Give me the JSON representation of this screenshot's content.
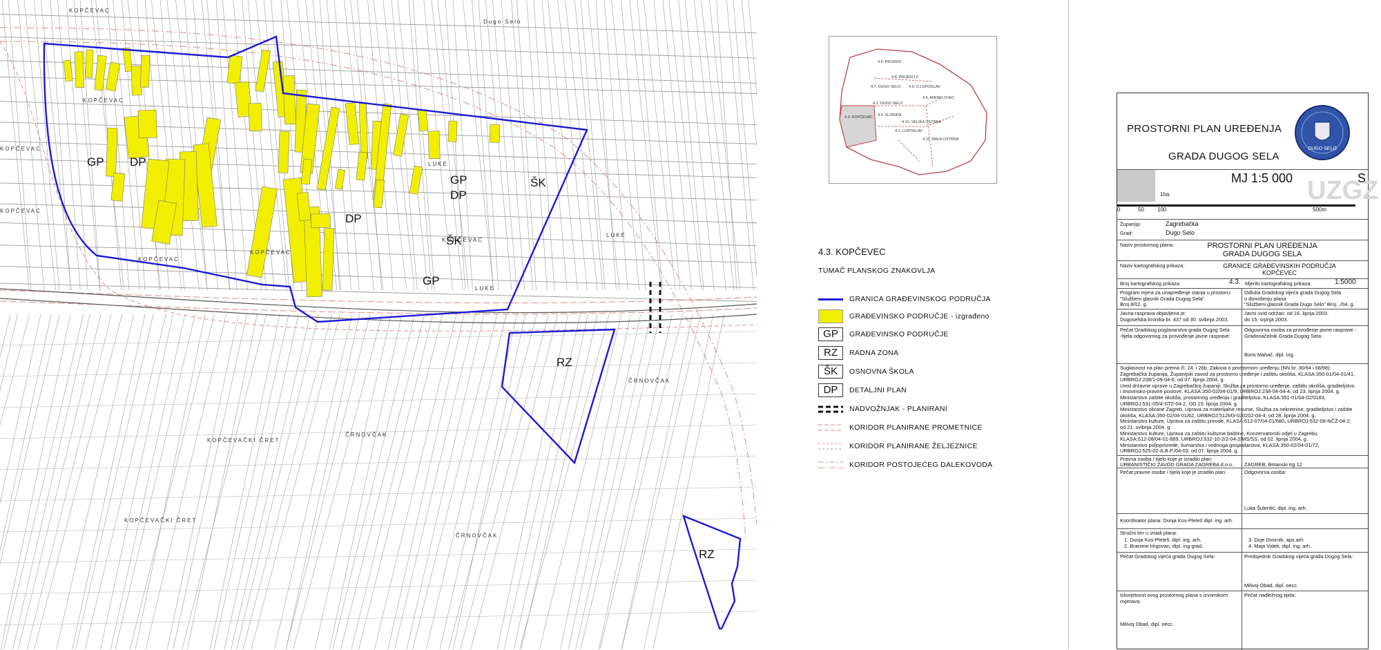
{
  "map": {
    "zone_labels": [
      {
        "text": "GP",
        "kind": "gp"
      },
      {
        "text": "DP",
        "kind": "dp"
      },
      {
        "text": "GP",
        "kind": "gp"
      },
      {
        "text": "DP",
        "kind": "dp"
      },
      {
        "text": "ŠK",
        "kind": "sk"
      },
      {
        "text": "DP",
        "kind": "dp"
      },
      {
        "text": "ŠK",
        "kind": "sk"
      },
      {
        "text": "GP",
        "kind": "gp"
      },
      {
        "text": "RZ",
        "kind": "rz"
      },
      {
        "text": "RZ",
        "kind": "rz"
      }
    ],
    "place_names": [
      "KOPČEVAC",
      "KOPČEVAC",
      "KOPČEVAC",
      "KOPČEVAC",
      "KOPČEVAC",
      "KOPČEVAC",
      "KOPČEVAC",
      "LUKE",
      "LUKE",
      "LUKE",
      "ČRNOVČAK",
      "ČRNOVČAK",
      "ČRNOVČAK",
      "KOPČEVAČKI ČRET",
      "KOPČEVAČKI ČRET",
      "Dugo Selo"
    ],
    "colors": {
      "boundary": "#1a1ad6",
      "built": "#f2ee00",
      "corridor": "#e08a8a"
    }
  },
  "index_map": {
    "areas": [
      "4.6. PRIJEKO",
      "4.8. PRIJEKO II",
      "4.7. DUGO SELO",
      "4.9. O.LUPOGLAV",
      "4.1. DUGO SELO",
      "4.5. ANDRILOVEC",
      "4.3. KOPČEVAC",
      "4.4. FLORIDA",
      "4.10. VELIKA OSTRNA",
      "4.2. LUPOGLAV",
      "4.11. MALA OSTRNA"
    ],
    "highlighted": "4.3. KOPČEVAC"
  },
  "legend": {
    "title": "4.3. KOPČEVEC",
    "subtitle": "TUMAČ PLANSKOG ZNAKOVLJA",
    "items": [
      {
        "symbol": "line-blue",
        "label": "GRANICA GRAĐEVINSKOG PODRUČJA"
      },
      {
        "symbol": "fill-yellow",
        "label": "GRAĐEVINSKO PODRUČJE - izgrađeno"
      },
      {
        "symbol": "GP",
        "label": "GRAĐEVINSKO PODRUČJE"
      },
      {
        "symbol": "RZ",
        "label": "RADNA ZONA"
      },
      {
        "symbol": "ŠK",
        "label": "OSNOVNA ŠKOLA"
      },
      {
        "symbol": "DP",
        "label": "DETALJNI PLAN"
      },
      {
        "symbol": "dashes",
        "label": "NADVOŽNJAK - PLANIRANI"
      },
      {
        "symbol": "corridor-road",
        "label": "KORIDOR PLANIRANE PROMETNICE"
      },
      {
        "symbol": "corridor-rail",
        "label": "KORIDOR PLANIRANE ŽELJEZNICE"
      },
      {
        "symbol": "corridor-power",
        "label": "KORIDOR POSTOJEĆEG DALEKOVODA"
      }
    ]
  },
  "title_block": {
    "title_line1": "PROSTORNI PLAN UREĐENJA",
    "title_line2": "GRADA DUGOG SELA",
    "seal_text": "DUGO SELO",
    "scale_label": "MJ 1:5 000",
    "north": "S",
    "watermark": "UZGZ",
    "scale_area": "1ha",
    "scale_ticks": [
      "0",
      "50",
      "100",
      "500m"
    ],
    "zupanija_label": "Županija:",
    "zupanija": "Zagrebačka",
    "grad_label": "Grad:",
    "grad": "Dugo Selo",
    "plan_name_label": "Naziv prostornog plana:",
    "plan_name": "PROSTORNI PLAN UREĐENJA\nGRADA DUGOG SELA",
    "map_name_label": "Naziv kartografskog prikaza:",
    "map_name": "GRANICE GRAĐEVINSKIH PODRUČJA\nKOPČEVEC",
    "map_no_label": "Broj kartografskog prikaza:",
    "map_no": "4.3.",
    "map_scale_label": "Mjerilo kartografskog prikaza:",
    "map_scale": "1:5000",
    "program_text": "Program mjera za unapređenje stanja u prostoru:\n\"Službeni glasnik Grada Dugog Sela\"\nBroj 8/02. g.",
    "odluka_text": "Odluka Gradskog vijeća grada Dugog Sela\no donošenju plana:\n\"Službeni glasnik Grada Dugo Selo\"    Broj. ./04. g.",
    "javna_text": "Javna rasprava objavljena je:\nDugoselska kronika br. 437 od 30. svibnja 2003.",
    "uvid_text": "Javni uvid održan:    od 16. lipnja 2003.\n                              do 15. srpnja 2003.",
    "pecat_pog_text": "Pečat Gradskog poglavarstva grada Dugog Sela\n-tijela odgovornog za provođenje javne rasprave:",
    "odgovorna_text": "Odgovorna osoba za provođenje javne rasprave -\nGradonačelnik Grada Dugog Sela:",
    "odgovorna_name": "Boris Mahač, dipl. ing.",
    "suglasnost_text": "Suglasnost na plan prema čl. 24. i 26b. Zakona o prostornom uređenju (NN br. 30/94 i 68/98):\nZagrebačka županija, Županijski zavod za prostorno uređenje i zaštitu okoliša, KLASA:350-01/04-01/41,\nURBROJ:238/1-09-04-6, od 07. lipnja 2004. g.\nUred državne uprave u Zagrebačkoj županiji, Služba za prostorno uređenje, zaštitu okoliša, graditeljstvo\ni imovinsko-pravne poslove, KLASA:350-02/04-01/9, URBROJ:238-04-04-4, od 23. lipnja 2004. g.\nMinistarstvo zaštite okoliša, prostornog uređenja i graditeljstva, KLASA:351-01/04-02/0183,\nURBROJ:531-05/4-STZ-04-2, OD 15. lipnja 2004. g.\nMinistarstvo obrane Zagreb, Uprava za materijalne resurse, Služba za nekretnine, graditeljstvo i zaštite\nokoliša, KLASA:350-02/04-01/62, URBROJ:512M3-020202-04-4, od 28. lipnja 2004. g.\nMinistarstvo kulture, Uprava za zaštitu prirode, KLASA:612-07/04-01/680, URBROJ:532-08-NČŽ-04-2,\nod 21. svibnja 2004. g.\nMinistarstvo kulture, Uprava za zaštitu kulturne baštine, Konzervatorski odjel u Zagrebu,\nKLASA:612-08/04-01-889, URBROJ:532-10-2/2-04-2/MS/SS, od 02. lipnja 2004. g.\nMinistarstvo poljoprivrede, šumarstva i vodnoga gospodarstva, KLASA:350-02/04-01/72,\nURBROJ:525-02-A.B.P./04-03, od 07. lipnja 2004. g.",
    "pravna_label": "Pravna osoba / tijelo koje je izradilo plan:",
    "pravna_name": "URBANISTIČKI ZAVOD GRADA ZAGREBA d.o.o.",
    "pravna_addr": "ZAGREB, Britanski trg 12",
    "pecat_pravne": "Pečat pravne osobe / tijela koje je izradilo plan:",
    "odgovorna_osoba_label": "Odgovorna osoba:",
    "odgovorna_osoba_name": "Luka Šulentić, dipl. ing. arh.",
    "koordinator": "Koordinator plana:  Dunja Kos-Pleteš dipl. ing. arh.",
    "strucni_label": "Stručni tim u izradi plana:",
    "strucni_left": "1. Dunja Kos-Pleteš, dipl. ing. arh.\n2. Branimir Hrgovan, dipl. ing grad.",
    "strucni_right": "3. Duje Dvornik, aps.arh.\n4. Maja Videk, dipl. ing. arh.",
    "pecat_vijeca": "Pečat Gradskog vijeća grada Dugog Sela:",
    "predsjednik": "Predsjednik Gradskog vijeća grada Dugog Sela:",
    "predsjednik_name": "Milivoj Obad, dipl. oecc.",
    "istovjetnost": "Istovjetnost ovog prostornog plana s izvornikom\novjerava:",
    "istovjetnost_name": "Milivoj Obad, dipl. oecc.",
    "pecat_tijela": "Pečat nadležnog tijela:"
  }
}
